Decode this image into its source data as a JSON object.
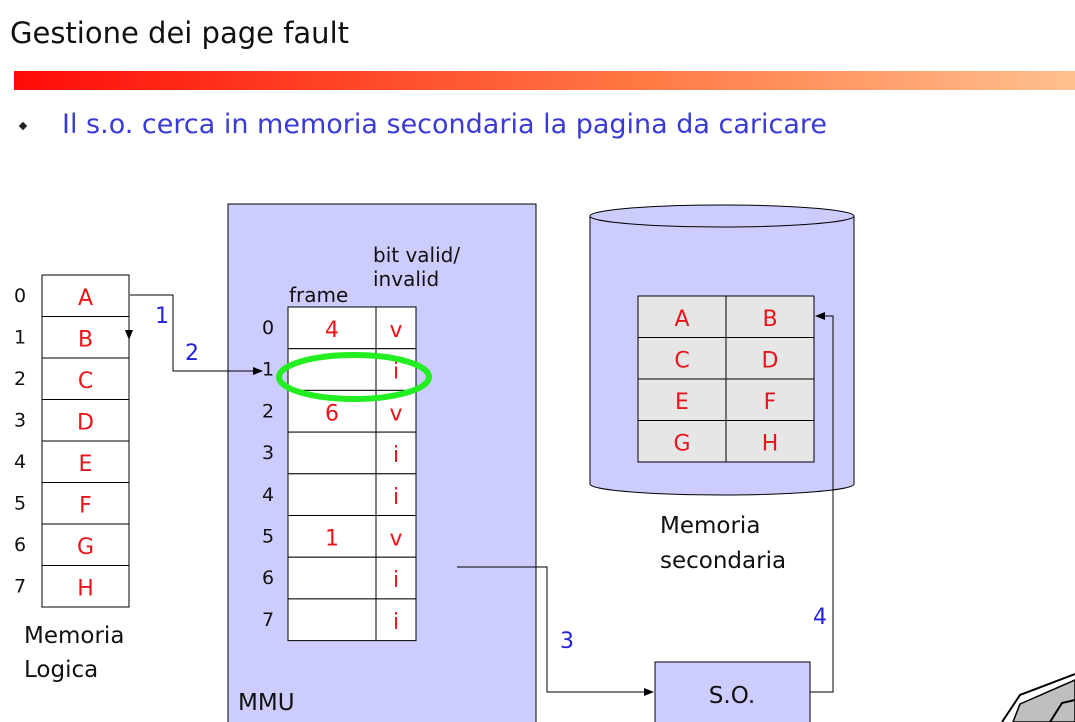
{
  "title": "Gestione dei page fault",
  "bullet": "Il s.o. cerca in memoria secondaria la pagina da caricare",
  "logical_memory": {
    "label_lines": [
      "Memoria",
      "Logica"
    ],
    "rows": [
      {
        "index": "0",
        "page": "A"
      },
      {
        "index": "1",
        "page": "B"
      },
      {
        "index": "2",
        "page": "C"
      },
      {
        "index": "3",
        "page": "D"
      },
      {
        "index": "4",
        "page": "E"
      },
      {
        "index": "5",
        "page": "F"
      },
      {
        "index": "6",
        "page": "G"
      },
      {
        "index": "7",
        "page": "H"
      }
    ]
  },
  "mmu": {
    "label": "MMU",
    "frame_header": "frame",
    "bit_header_lines": [
      "bit valid/",
      "invalid"
    ],
    "rows": [
      {
        "index": "0",
        "frame": "4",
        "bit": "v"
      },
      {
        "index": "1",
        "frame": "",
        "bit": "i"
      },
      {
        "index": "2",
        "frame": "6",
        "bit": "v"
      },
      {
        "index": "3",
        "frame": "",
        "bit": "i"
      },
      {
        "index": "4",
        "frame": "",
        "bit": "i"
      },
      {
        "index": "5",
        "frame": "1",
        "bit": "v"
      },
      {
        "index": "6",
        "frame": "",
        "bit": "i"
      },
      {
        "index": "7",
        "frame": "",
        "bit": "i"
      }
    ],
    "highlighted_row": 1
  },
  "secondary_memory": {
    "label_lines": [
      "Memoria",
      "secondaria"
    ],
    "grid": [
      [
        "A",
        "B"
      ],
      [
        "C",
        "D"
      ],
      [
        "E",
        "F"
      ],
      [
        "G",
        "H"
      ]
    ]
  },
  "os_box": {
    "label": "S.O."
  },
  "steps": [
    "1",
    "2",
    "3",
    "4"
  ],
  "colors": {
    "accent_red": "#e8141a",
    "step_blue": "#2222dd",
    "mmu_fill": "#ccccff",
    "highlight_green": "#22ee22",
    "grid_cell": "#e6e6e6"
  }
}
